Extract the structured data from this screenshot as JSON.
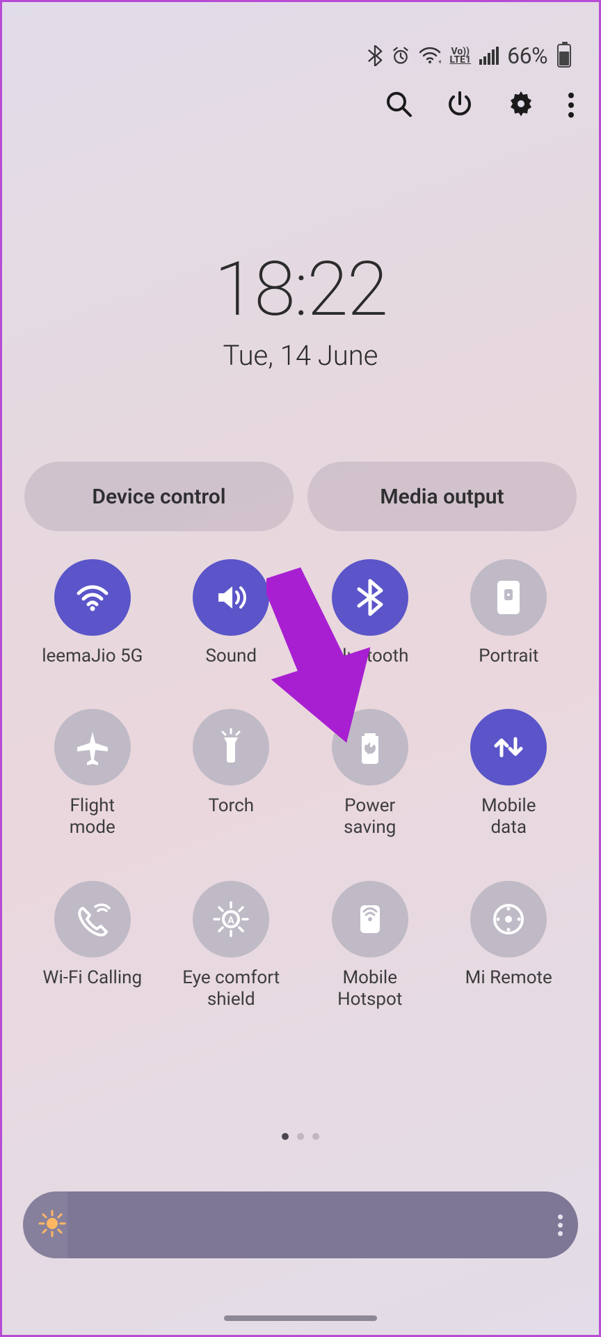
{
  "status": {
    "battery_pct": "66%",
    "lte_top": "Vo))",
    "lte_bottom": "LTE1"
  },
  "clock": {
    "time": "18:22",
    "date": "Tue, 14 June"
  },
  "pills": {
    "device_control": "Device control",
    "media_output": "Media output"
  },
  "tiles": [
    {
      "label": "leemaJio 5G",
      "active": true,
      "icon": "wifi"
    },
    {
      "label": "Sound",
      "active": true,
      "icon": "sound"
    },
    {
      "label": "Bluetooth",
      "active": true,
      "icon": "bluetooth"
    },
    {
      "label": "Portrait",
      "active": false,
      "icon": "portrait"
    },
    {
      "label": "Flight\nmode",
      "active": false,
      "icon": "airplane"
    },
    {
      "label": "Torch",
      "active": false,
      "icon": "torch"
    },
    {
      "label": "Power\nsaving",
      "active": false,
      "icon": "power-saving"
    },
    {
      "label": "Mobile\ndata",
      "active": true,
      "icon": "mobile-data"
    },
    {
      "label": "Wi-Fi Calling",
      "active": false,
      "icon": "wifi-calling"
    },
    {
      "label": "Eye comfort\nshield",
      "active": false,
      "icon": "eye-comfort"
    },
    {
      "label": "Mobile\nHotspot",
      "active": false,
      "icon": "hotspot"
    },
    {
      "label": "Mi Remote",
      "active": false,
      "icon": "remote"
    }
  ],
  "pager": {
    "pages": 3,
    "active": 0
  },
  "colors": {
    "tile_on": "#5b55c9",
    "tile_off": "#bfbac6",
    "annotation": "#a81fd1"
  }
}
